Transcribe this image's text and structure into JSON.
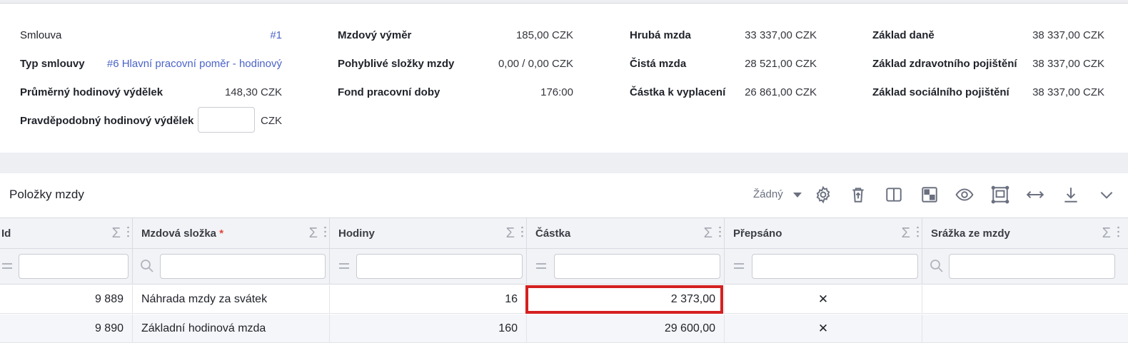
{
  "summary": {
    "contract_label": "Smlouva",
    "contract_value": "#1",
    "contract_type_label": "Typ smlouvy",
    "contract_type_value": "#6 Hlavní pracovní poměr - hodinový",
    "avg_hourly_label": "Průměrný hodinový výdělek",
    "avg_hourly_value": "148,30 CZK",
    "probable_hourly_label": "Pravděpodobný hodinový výdělek",
    "probable_hourly_value": "",
    "probable_hourly_unit": "CZK",
    "wage_assessment_label": "Mzdový výměr",
    "wage_assessment_value": "185,00 CZK",
    "variable_label": "Pohyblivé složky mzdy",
    "variable_value": "0,00 / 0,00 CZK",
    "work_fund_label": "Fond pracovní doby",
    "work_fund_value": "176:00",
    "gross_label": "Hrubá mzda",
    "gross_value": "33 337,00 CZK",
    "net_label": "Čistá mzda",
    "net_value": "28 521,00 CZK",
    "payout_label": "Částka k vyplacení",
    "payout_value": "26 861,00 CZK",
    "tax_base_label": "Základ daně",
    "tax_base_value": "38 337,00 CZK",
    "health_base_label": "Základ zdravotního pojištění",
    "health_base_value": "38 337,00 CZK",
    "social_base_label": "Základ sociálního pojištění",
    "social_base_value": "38 337,00 CZK"
  },
  "panel": {
    "title": "Položky mzdy",
    "view_select": "Žádný",
    "icons": [
      "gear-icon",
      "delete-icon",
      "columns-icon",
      "layout-icon",
      "eye-icon",
      "frame-icon",
      "expand-horizontal-icon",
      "download-icon",
      "chevron-down-icon"
    ]
  },
  "table": {
    "columns": [
      {
        "label": "Id",
        "required": false,
        "filter": "equals"
      },
      {
        "label": "Mzdová složka",
        "required": true,
        "filter": "search"
      },
      {
        "label": "Hodiny",
        "required": false,
        "filter": "equals"
      },
      {
        "label": "Částka",
        "required": false,
        "filter": "equals"
      },
      {
        "label": "Přepsáno",
        "required": false,
        "filter": "equals"
      },
      {
        "label": "Srážka ze mzdy",
        "required": false,
        "filter": "search"
      }
    ],
    "required_mark": "*",
    "rows": [
      {
        "id": "9 889",
        "component": "Náhrada mzdy za svátek",
        "hours": "16",
        "amount": "2 373,00",
        "overridden": "✕",
        "deduction": ""
      },
      {
        "id": "9 890",
        "component": "Základní hodinová mzda",
        "hours": "160",
        "amount": "29 600,00",
        "overridden": "✕",
        "deduction": ""
      }
    ]
  },
  "colors": {
    "link": "#4a63c8",
    "highlight_border": "#d42020",
    "required": "#e0443c"
  }
}
